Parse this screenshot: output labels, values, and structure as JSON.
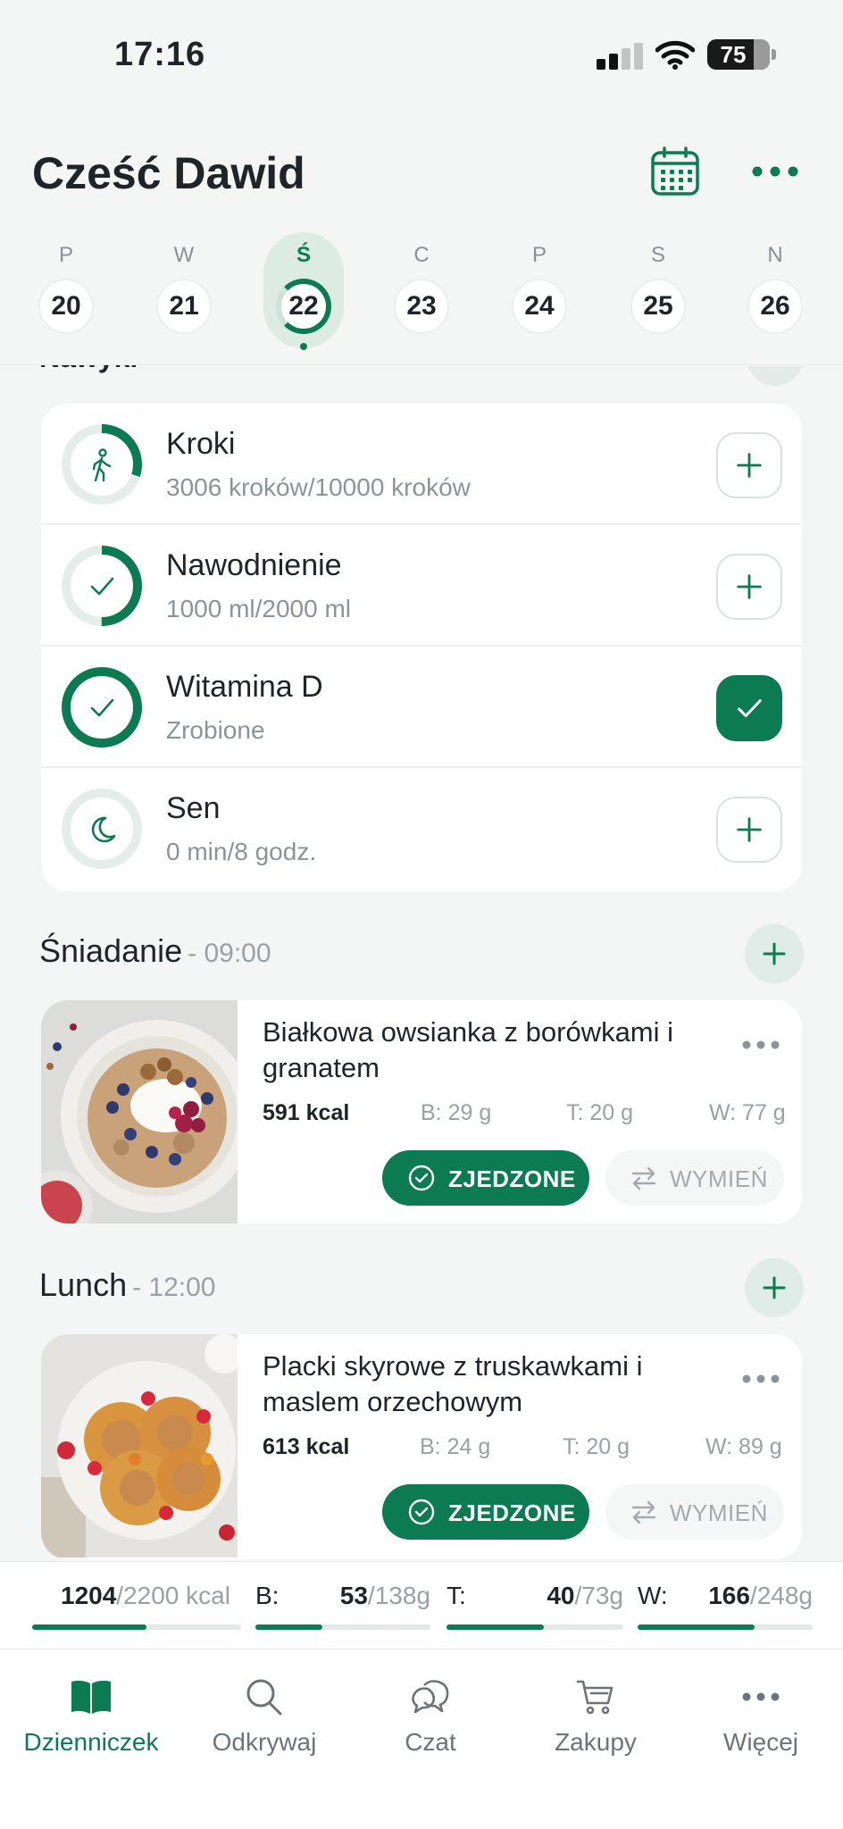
{
  "status_bar": {
    "time": "17:16",
    "battery": "75"
  },
  "header": {
    "greeting": "Cześć Dawid"
  },
  "week": [
    {
      "name": "P",
      "num": "20"
    },
    {
      "name": "W",
      "num": "21"
    },
    {
      "name": "Ś",
      "num": "22",
      "selected": true
    },
    {
      "name": "C",
      "num": "23"
    },
    {
      "name": "P",
      "num": "24"
    },
    {
      "name": "S",
      "num": "25"
    },
    {
      "name": "N",
      "num": "26"
    }
  ],
  "habits_section": {
    "title": "Nawyki"
  },
  "habits": [
    {
      "name": "Kroki",
      "sub": "3006 kroków/10000 kroków",
      "icon": "walking-icon",
      "progress": 0.3,
      "done": false
    },
    {
      "name": "Nawodnienie",
      "sub": "1000 ml/2000 ml",
      "icon": "check-icon",
      "progress": 0.5,
      "done": false
    },
    {
      "name": "Witamina D",
      "sub": "Zrobione",
      "icon": "check-icon",
      "progress": 1.0,
      "done": true
    },
    {
      "name": "Sen",
      "sub": "0 min/8 godz.",
      "icon": "moon-icon",
      "progress": 0.0,
      "done": false
    }
  ],
  "meals": [
    {
      "section": "Śniadanie",
      "time": "- 09:00",
      "title": "Białkowa owsianka z borówkami i granatem",
      "kcal": "591 kcal",
      "protein": "B: 29 g",
      "fat": "T: 20 g",
      "carbs": "W: 77 g",
      "eaten_label": "ZJEDZONE",
      "swap_label": "WYMIEŃ"
    },
    {
      "section": "Lunch",
      "time": "- 12:00",
      "title": "Placki skyrowe z truskawkami i maslem orzechowym",
      "kcal": "613 kcal",
      "protein": "B: 24 g",
      "fat": "T: 20 g",
      "carbs": "W: 89 g",
      "eaten_label": "ZJEDZONE",
      "swap_label": "WYMIEŃ"
    }
  ],
  "macros": {
    "kcal": {
      "value": "1204",
      "total": "/2200 kcal",
      "progress": 0.547
    },
    "protein": {
      "label": "B:",
      "value": "53",
      "total": "/138g",
      "progress": 0.384
    },
    "fat": {
      "label": "T:",
      "value": "40",
      "total": "/73g",
      "progress": 0.548
    },
    "carbs": {
      "label": "W:",
      "value": "166",
      "total": "/248g",
      "progress": 0.669
    }
  },
  "nav": [
    {
      "label": "Dzienniczek",
      "icon": "book-icon",
      "active": true
    },
    {
      "label": "Odkrywaj",
      "icon": "search-icon",
      "active": false
    },
    {
      "label": "Czat",
      "icon": "chat-icon",
      "active": false
    },
    {
      "label": "Zakupy",
      "icon": "cart-icon",
      "active": false
    },
    {
      "label": "Więcej",
      "icon": "more-icon",
      "active": false
    }
  ],
  "colors": {
    "accent": "#0c7a52",
    "accent_light": "#dcece5",
    "background": "#f4f5f5"
  }
}
